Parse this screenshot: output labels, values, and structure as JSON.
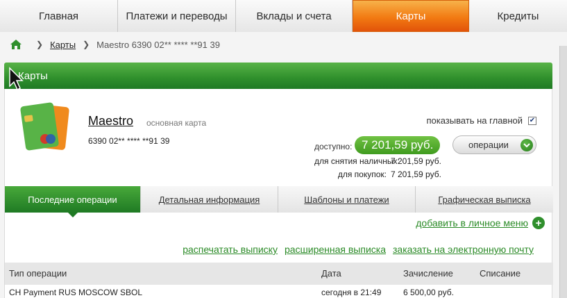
{
  "nav": {
    "tabs": [
      "Главная",
      "Платежи и переводы",
      "Вклады и счета",
      "Карты",
      "Кредиты"
    ],
    "active": "Карты"
  },
  "breadcrumb": {
    "items": [
      "Карты",
      "Maestro 6390 02** **** **91 39"
    ]
  },
  "section": {
    "title": "Карты"
  },
  "card": {
    "name": "Maestro",
    "type": "основная карта",
    "number": "6390 02** **** **91 39",
    "show_on_main_label": "показывать на главной",
    "show_on_main_checked": true,
    "available_label": "доступно:",
    "available_value": "7 201,59 руб.",
    "operations_label": "операции",
    "cash_label": "для снятия наличных:",
    "cash_value": "7 201,59 руб.",
    "purchases_label": "для покупок:",
    "purchases_value": "7 201,59 руб."
  },
  "tabs": [
    "Последние операции",
    "Детальная информация",
    "Шаблоны и платежи",
    "Графическая выписка"
  ],
  "active_tab": "Последние операции",
  "add_to_menu": "добавить в личное меню",
  "actions": [
    "распечатать выписку",
    "расширенная выписка",
    "заказать на электронную почту"
  ],
  "table": {
    "columns": [
      "Тип операции",
      "Дата",
      "Зачисление",
      "Списание"
    ],
    "rows": [
      {
        "type": "CH Payment RUS MOSCOW SBOL",
        "date": "сегодня в 21:49",
        "credit": "6 500,00 руб.",
        "debit": ""
      }
    ]
  },
  "colors": {
    "brand_green": "#2f8f2c",
    "active_orange": "#f27a12",
    "link_green": "#2a8a26"
  }
}
